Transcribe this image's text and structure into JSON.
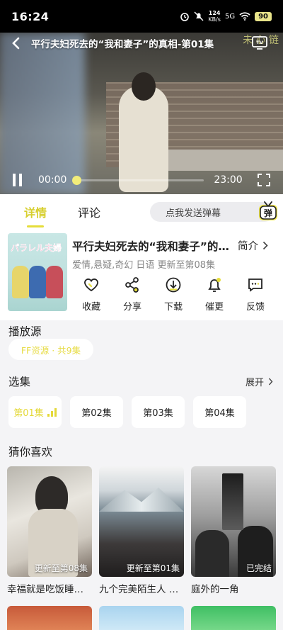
{
  "status": {
    "time": "16:24",
    "net_speed": "124",
    "net_unit": "KB/s",
    "signal": "5G",
    "battery": "90"
  },
  "video": {
    "title": "平行夫妇死去的“我和妻子”的真相-第01集",
    "watermark": "未 心 链",
    "current_time": "00:00",
    "duration": "23:00",
    "progress": 0
  },
  "tabs": {
    "details": "详情",
    "comments": "评论"
  },
  "danmu": {
    "placeholder": "点我发送弹幕",
    "button": "弹"
  },
  "detail": {
    "title": "平行夫妇死去的“我和妻子”的真相",
    "intro_label": "简介",
    "tags": "爱情,悬疑,奇幻 日语 更新至第08集",
    "poster_text": "パラレル夫婦",
    "actions": [
      {
        "icon": "heart-icon",
        "label": "收藏"
      },
      {
        "icon": "share-icon",
        "label": "分享"
      },
      {
        "icon": "download-icon",
        "label": "下载"
      },
      {
        "icon": "bell-icon",
        "label": "催更"
      },
      {
        "icon": "feedback-icon",
        "label": "反馈"
      }
    ]
  },
  "source": {
    "section_title": "播放源",
    "selected": "FF资源 · 共9集"
  },
  "episodes": {
    "section_title": "选集",
    "expand_label": "展开",
    "items": [
      "第01集",
      "第02集",
      "第03集",
      "第04集"
    ]
  },
  "recommend": {
    "section_title": "猜你喜欢",
    "items": [
      {
        "title": "幸福就是吃饭睡觉等待",
        "badge": "更新至第08集"
      },
      {
        "title": "九个完美陌生人 第二季",
        "badge": "更新至第01集"
      },
      {
        "title": "庭外的一角",
        "badge": "已完结"
      }
    ]
  },
  "colors": {
    "accent": "#e5dd3a",
    "background": "#f4f4f6"
  }
}
